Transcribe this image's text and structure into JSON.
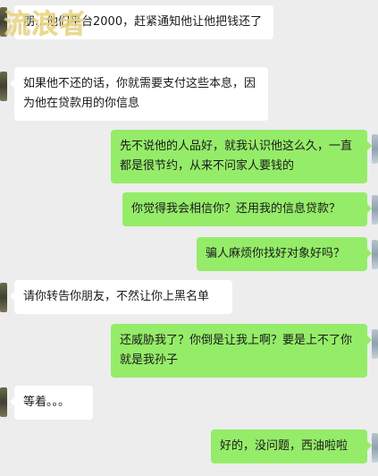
{
  "watermark": "流浪者",
  "messages": [
    {
      "side": "left",
      "text": "朋…他们平台2000，赶紧通知他让他把钱还了"
    },
    {
      "side": "left",
      "text": "如果他不还的话，你就需要支付这些本息，因为他在贷款用的你信息"
    },
    {
      "side": "right",
      "text": "先不说他的人品好，就我认识他这么久，一直都是很节约，从来不问家人要钱的"
    },
    {
      "side": "right",
      "text": "你觉得我会相信你？还用我的信息贷款？"
    },
    {
      "side": "right",
      "text": "骗人麻烦你找好对象好吗？"
    },
    {
      "side": "left",
      "text": "请你转告你朋友，不然让你上黑名单"
    },
    {
      "side": "right",
      "text": "还威胁我了？你倒是让我上啊？要是上不了你就是我孙子"
    },
    {
      "side": "left",
      "text": "等着。。。"
    },
    {
      "side": "right",
      "text": "好的，没问题，西油啦啦"
    }
  ],
  "colors": {
    "background": "#ededed",
    "incoming_bubble": "#ffffff",
    "outgoing_bubble": "#95ec69",
    "watermark": "#e8d27a"
  }
}
